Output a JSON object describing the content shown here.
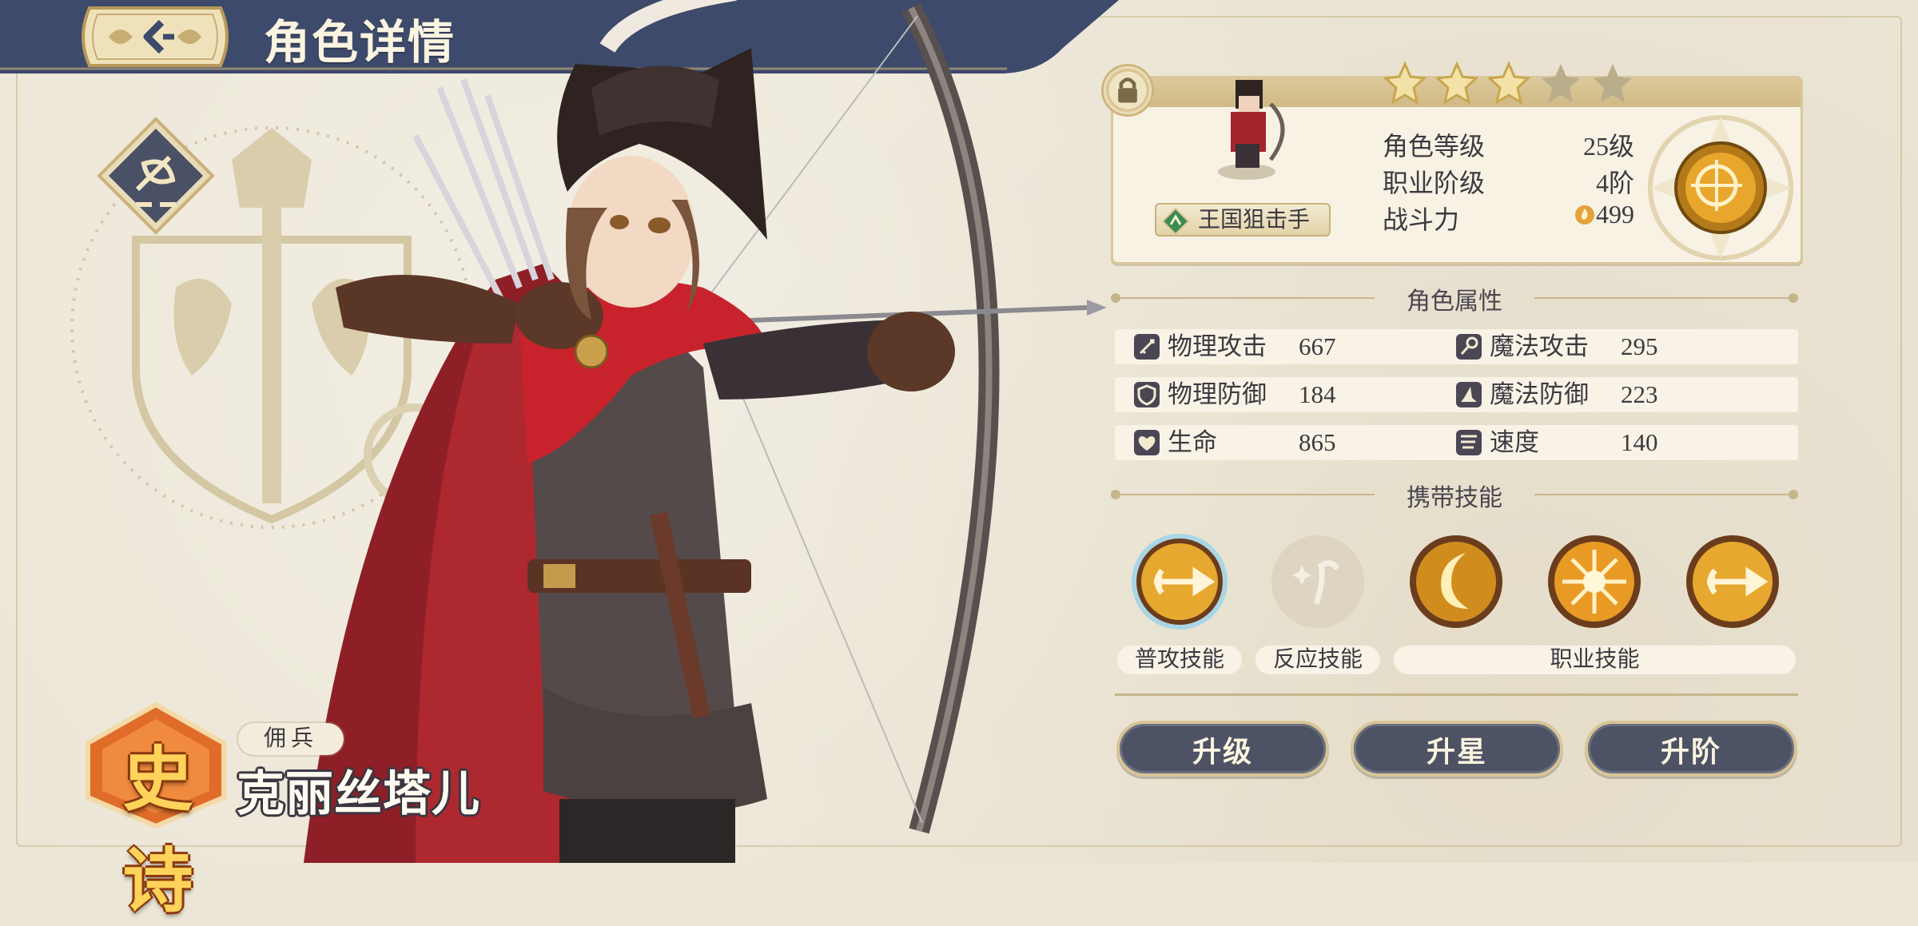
{
  "header": {
    "title": "角色详情"
  },
  "character": {
    "rarity": "史诗",
    "role": "佣兵",
    "name": "克丽丝塔儿"
  },
  "info": {
    "stars_total": 5,
    "stars_filled": 3,
    "job_name": "王国狙击手",
    "stats": [
      {
        "label": "角色等级",
        "value": "25级"
      },
      {
        "label": "职业阶级",
        "value": "4阶"
      },
      {
        "label": "战斗力",
        "value": "499"
      }
    ]
  },
  "attributes": {
    "heading": "角色属性",
    "rows": [
      {
        "left_label": "物理攻击",
        "left_value": "667",
        "right_label": "魔法攻击",
        "right_value": "295"
      },
      {
        "left_label": "物理防御",
        "left_value": "184",
        "right_label": "魔法防御",
        "right_value": "223"
      },
      {
        "left_label": "生命",
        "left_value": "865",
        "right_label": "速度",
        "right_value": "140"
      }
    ],
    "icons": [
      "sword-icon",
      "wand-icon",
      "shield-icon",
      "hat-icon",
      "heart-icon",
      "wing-icon"
    ]
  },
  "skills": {
    "heading": "携带技能",
    "labels": {
      "basic": "普攻技能",
      "reaction": "反应技能",
      "job": "职业技能"
    }
  },
  "actions": {
    "level_up": "升级",
    "star_up": "升星",
    "rank_up": "升阶"
  },
  "colors": {
    "banner": "#3d4a6b",
    "button": "#4d5264",
    "gold": "#d8c496",
    "paper": "#ebe5d5"
  }
}
